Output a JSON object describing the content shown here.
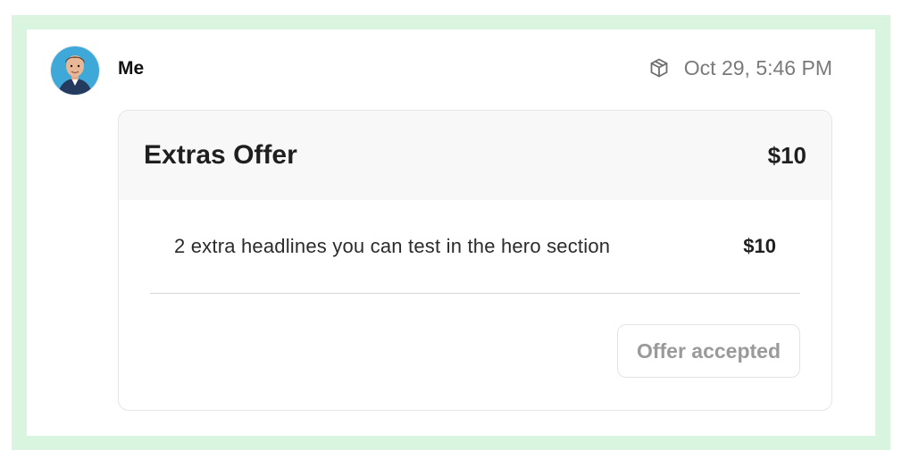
{
  "message": {
    "sender": "Me",
    "timestamp": "Oct 29, 5:46 PM",
    "timestamp_icon": "package-icon",
    "avatar": "user-avatar-photo"
  },
  "offer": {
    "title": "Extras Offer",
    "total": "$10",
    "items": [
      {
        "description": "2 extra headlines you can test in the hero section",
        "price": "$10"
      }
    ],
    "status_button_label": "Offer accepted"
  },
  "colors": {
    "frame_border": "#d9f5e0",
    "header_bg": "#f8f8f8",
    "muted_text": "#7a7a7a"
  }
}
